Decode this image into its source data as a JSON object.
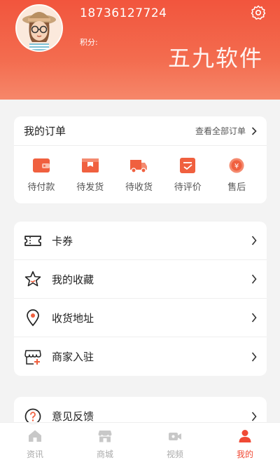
{
  "profile": {
    "phone": "18736127724",
    "points_label": "积分:",
    "watermark": "五九软件"
  },
  "orders": {
    "title": "我的订单",
    "view_all": "查看全部订单",
    "items": [
      {
        "label": "待付款",
        "icon": "wallet-icon"
      },
      {
        "label": "待发货",
        "icon": "package-icon"
      },
      {
        "label": "待收货",
        "icon": "truck-icon"
      },
      {
        "label": "待评价",
        "icon": "review-icon"
      },
      {
        "label": "售后",
        "icon": "after-sales-icon"
      }
    ]
  },
  "menu": [
    {
      "label": "卡券",
      "icon": "ticket-icon"
    },
    {
      "label": "我的收藏",
      "icon": "star-icon"
    },
    {
      "label": "收货地址",
      "icon": "location-pin-icon"
    },
    {
      "label": "商家入驻",
      "icon": "store-add-icon"
    }
  ],
  "feedback": {
    "label": "意见反馈",
    "icon": "question-icon"
  },
  "tabs": [
    {
      "label": "资讯",
      "icon": "home-icon"
    },
    {
      "label": "商城",
      "icon": "shop-icon"
    },
    {
      "label": "视频",
      "icon": "video-icon"
    },
    {
      "label": "我的",
      "icon": "person-icon",
      "active": true
    }
  ],
  "colors": {
    "accent": "#f04a35",
    "header_top": "#f2553d",
    "header_bottom": "#f6876a",
    "background": "#f3f3f3"
  }
}
